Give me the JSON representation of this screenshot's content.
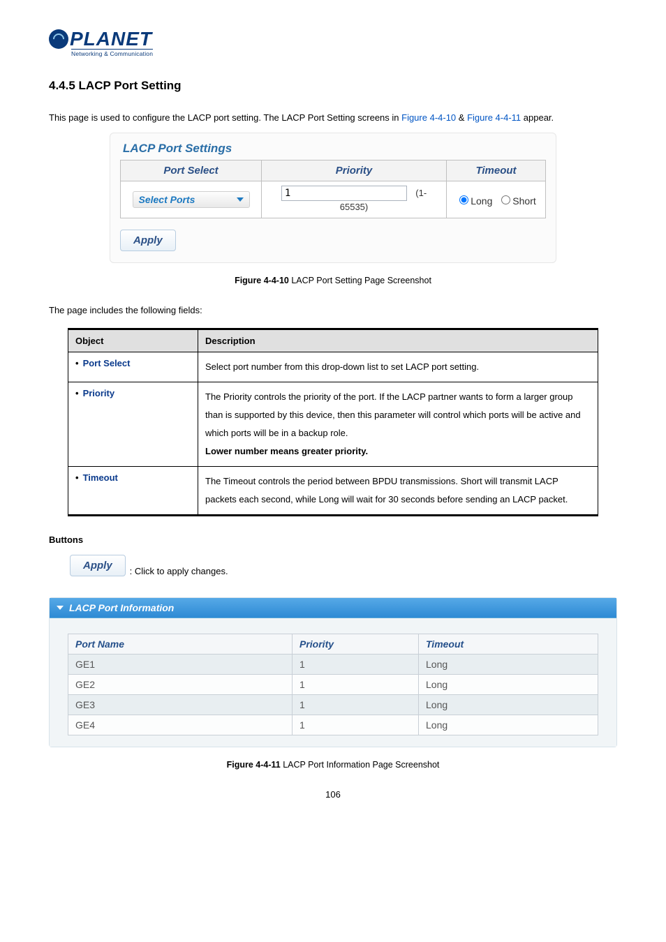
{
  "logo": {
    "brand": "PLANET",
    "tagline": "Networking & Communication"
  },
  "heading": "4.4.5 LACP Port Setting",
  "intro": {
    "pre": "This page is used to configure the LACP port setting. The LACP Port Setting screens in ",
    "link1": "Figure 4-4-10",
    "amp": " & ",
    "link2": "Figure 4-4-11",
    "post": " appear."
  },
  "settings_panel": {
    "title": "LACP Port Settings",
    "headers": {
      "port_select": "Port Select",
      "priority": "Priority",
      "timeout": "Timeout"
    },
    "port_select_label": "Select Ports",
    "priority_value": "1",
    "priority_range": "(1-65535)",
    "timeout_long": "Long",
    "timeout_short": "Short",
    "apply_label": "Apply"
  },
  "caption1": {
    "bold": "Figure 4-4-10",
    "rest": " LACP Port Setting Page Screenshot"
  },
  "includes_line": "The page includes the following fields:",
  "obj_table": {
    "col1": "Object",
    "col2": "Description",
    "rows": [
      {
        "name": "Port Select",
        "desc_html": "Select port number from this drop-down list to set LACP port setting."
      },
      {
        "name": "Priority",
        "desc_html": "The Priority controls the priority of the port. If the LACP partner wants to form a larger group than is supported by this device, then this parameter will control which ports will be active and which ports will be in a backup role.",
        "desc_strong": "Lower number means greater priority."
      },
      {
        "name": "Timeout",
        "desc_html": "The Timeout controls the period between BPDU transmissions. Short will transmit LACP packets each second, while Long will wait for 30 seconds before sending an LACP packet."
      }
    ]
  },
  "buttons_heading": "Buttons",
  "buttons_line": ": Click to apply changes.",
  "info_panel": {
    "title": "LACP Port Information",
    "headers": {
      "port_name": "Port Name",
      "priority": "Priority",
      "timeout": "Timeout"
    },
    "rows": [
      {
        "name": "GE1",
        "priority": "1",
        "timeout": "Long"
      },
      {
        "name": "GE2",
        "priority": "1",
        "timeout": "Long"
      },
      {
        "name": "GE3",
        "priority": "1",
        "timeout": "Long"
      },
      {
        "name": "GE4",
        "priority": "1",
        "timeout": "Long"
      }
    ]
  },
  "caption2": {
    "bold": "Figure 4-4-11",
    "rest": " LACP Port Information Page Screenshot"
  },
  "page_number": "106"
}
